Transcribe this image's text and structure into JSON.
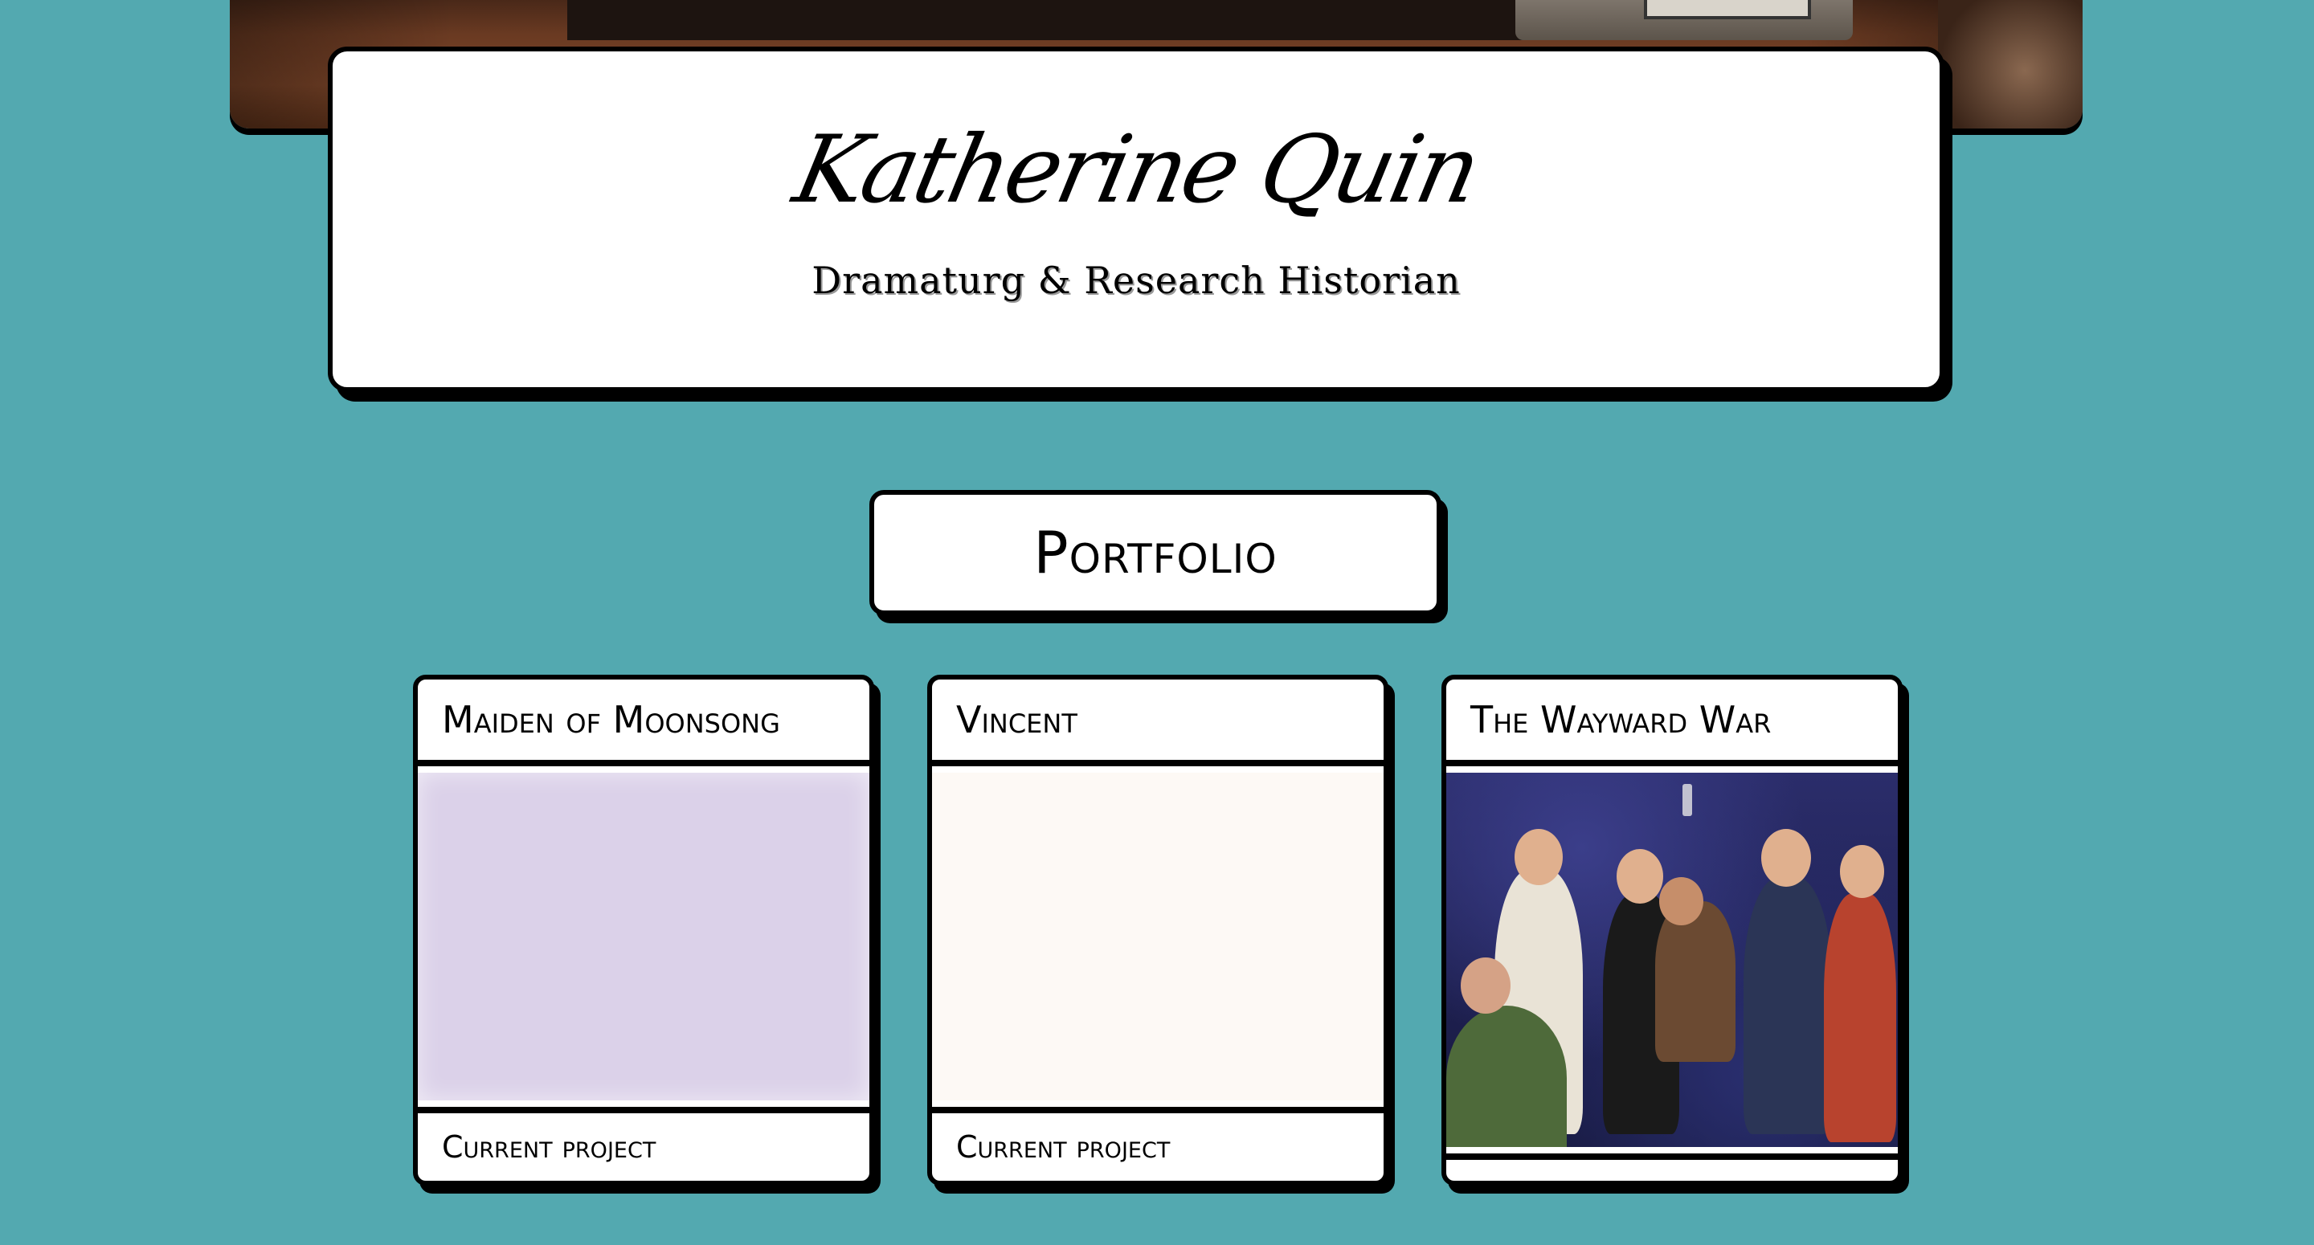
{
  "header": {
    "name": "Katherine Quin",
    "subtitle": "Dramaturg & Research Historian"
  },
  "portfolio": {
    "heading": "Portfolio",
    "projects": [
      {
        "title": "Maiden of Moonsong",
        "status": "Current project",
        "image_color": "#dbd1e9"
      },
      {
        "title": "Vincent",
        "status": "Current project",
        "image_color": "#fdf9f5"
      },
      {
        "title": "The Wayward War",
        "status": "",
        "image": "cast-toasting-photo"
      }
    ]
  },
  "colors": {
    "background": "#53a9b0",
    "card": "#ffffff",
    "border": "#000000"
  }
}
